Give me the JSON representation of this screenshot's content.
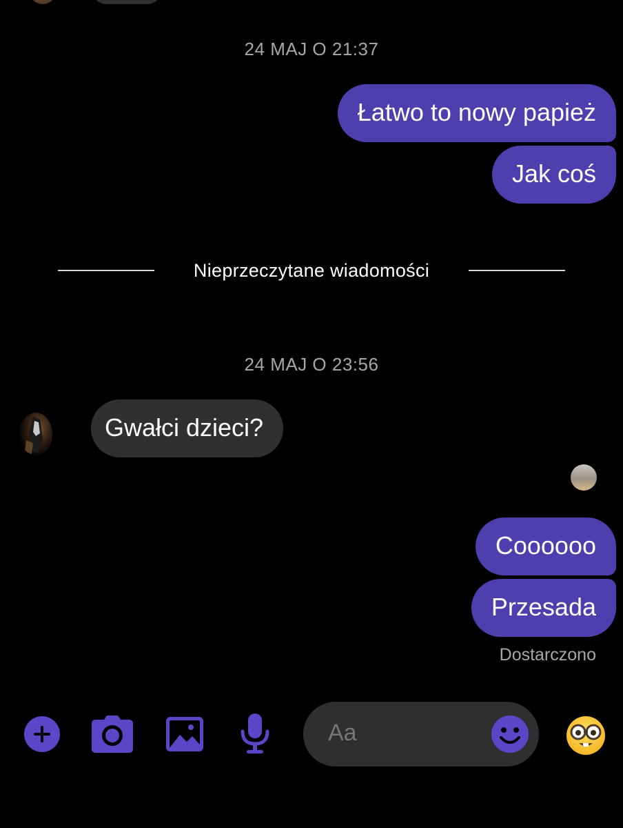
{
  "colors": {
    "background": "#000000",
    "outgoing_bubble": "#4e3fae",
    "incoming_bubble": "#303030",
    "accent": "#5a47c8",
    "muted_text": "#a7a7ab"
  },
  "conversation": {
    "timestamp_1": "24 MAJ O 21:37",
    "outgoing_1": "Łatwo to nowy papież",
    "outgoing_2": "Jak coś",
    "unread_divider": "Nieprzeczytane wiadomości",
    "timestamp_2": "24 MAJ O 23:56",
    "incoming_1": "Gwałci dzieci?",
    "outgoing_3": "Coooooo",
    "outgoing_4": "Przesada",
    "delivery_status": "Dostarczono"
  },
  "composer": {
    "placeholder": "Aa",
    "icons": [
      "plus-circle-icon",
      "camera-icon",
      "image-icon",
      "microphone-icon",
      "smiley-icon",
      "nerd-face-emoji-icon"
    ]
  }
}
